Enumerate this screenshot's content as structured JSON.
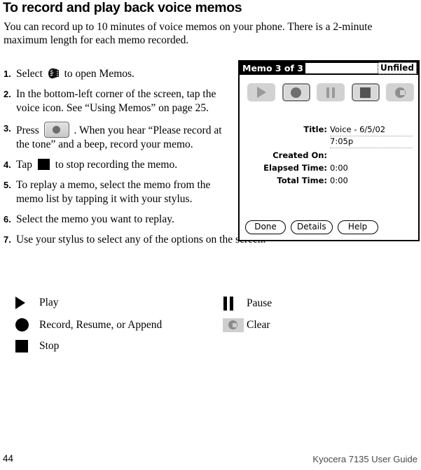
{
  "page": {
    "heading": "To record and play back voice memos",
    "intro": "You can record up to 10 minutes of voice memos on your phone. There is a 2-minute maximum length for each memo recorded.",
    "footer_page_number": "44",
    "footer_guide": "Kyocera 7135 User Guide"
  },
  "steps": [
    {
      "number": "1.",
      "text_before": "Select",
      "icon": "memos-app-icon",
      "text_after": "to open Memos."
    },
    {
      "number": "2.",
      "text_before": "In the bottom-left corner of the screen, tap the voice icon. See “Using Memos” on page 25.",
      "icon": "",
      "text_after": ""
    },
    {
      "number": "3.",
      "text_before": "Press",
      "icon": "record-button-icon",
      "text_after": ". When you hear “Please record at the tone” and a beep, record your memo."
    },
    {
      "number": "4.",
      "text_before": "Tap",
      "icon": "stop-button-icon",
      "text_after": "to stop recording the memo."
    },
    {
      "number": "5.",
      "text_before": "To replay a memo, select the memo from the memo list by tapping it with your stylus.",
      "icon": "",
      "text_after": ""
    },
    {
      "number": "6.",
      "text_before": "Select the memo you want to replay.",
      "icon": "",
      "text_after": ""
    },
    {
      "number": "7.",
      "text_before": "Use your stylus to select any of the options on the screen.",
      "icon": "",
      "text_after": ""
    }
  ],
  "legend": {
    "rows": [
      {
        "left_icon": "play-icon",
        "left_label": "Play",
        "right_icon": "pause-icon",
        "right_label": "Pause"
      },
      {
        "left_icon": "record-icon",
        "left_label": "Record, Resume, or Append",
        "right_icon": "clear-icon",
        "right_label": "Clear"
      },
      {
        "left_icon": "stop-icon",
        "left_label": "Stop",
        "right_icon": "",
        "right_label": ""
      }
    ]
  },
  "pda": {
    "title": "Memo 3 of 3",
    "category": "Unfiled",
    "toolbar_buttons": [
      {
        "name": "play-button",
        "glyph": "play",
        "pressed": false
      },
      {
        "name": "record-button",
        "glyph": "record",
        "pressed": true
      },
      {
        "name": "pause-button",
        "glyph": "pause",
        "pressed": false
      },
      {
        "name": "stop-button",
        "glyph": "stop",
        "pressed": true
      },
      {
        "name": "clear-button",
        "glyph": "clear",
        "pressed": false
      }
    ],
    "fields": [
      {
        "label": "Title:",
        "value_line1": "Voice - 6/5/02",
        "value_line2": "7:05p"
      },
      {
        "label": "Created On:",
        "value_line1": "",
        "value_line2": ""
      },
      {
        "label": "Elapsed Time:",
        "value_line1": "0:00",
        "value_line2": ""
      },
      {
        "label": "Total Time:",
        "value_line1": "0:00",
        "value_line2": ""
      }
    ],
    "actions": [
      {
        "label": "Done"
      },
      {
        "label": "Details"
      },
      {
        "label": "Help"
      }
    ]
  },
  "colors": {
    "page_background": "#ffffff",
    "text": "#000000",
    "pda_titlebar": "#000000",
    "button_face": "#d2d2d2",
    "button_glyph": "#8e8e8e",
    "footer_guide": "#4a4a4a"
  }
}
